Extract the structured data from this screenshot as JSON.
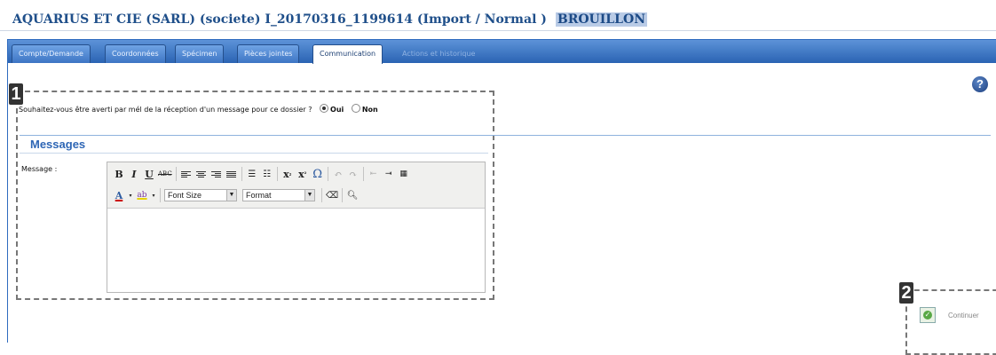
{
  "header": {
    "title": "AQUARIUS ET CIE (SARL) (societe)  I_20170316_1199614 (Import / Normal )",
    "status": "BROUILLON"
  },
  "tabs": [
    {
      "label": "Compte/Demande",
      "state": "normal"
    },
    {
      "label": "Coordonnées",
      "state": "normal"
    },
    {
      "label": "Spécimen",
      "state": "normal"
    },
    {
      "label": "Pièces jointes",
      "state": "normal"
    },
    {
      "label": "Communication",
      "state": "active"
    },
    {
      "label": "Actions et historique",
      "state": "disabled"
    }
  ],
  "help_icon": "question-mark-icon",
  "callouts": [
    "1",
    "2"
  ],
  "notification": {
    "question": "Souhaitez-vous être averti par mél de la réception d'un message pour ce dossier ?",
    "options": [
      {
        "label": "Oui",
        "selected": true
      },
      {
        "label": "Non",
        "selected": false
      }
    ]
  },
  "messages": {
    "section_title": "Messages",
    "message_label": "Message :",
    "editor": {
      "font_size_placeholder": "Font Size",
      "format_placeholder": "Format",
      "content": ""
    }
  },
  "continue": {
    "label": "Continuer",
    "icon": "check-circle-icon"
  },
  "colors": {
    "title": "#1f4f8a",
    "status_bg": "#b9cbe6",
    "tab_bar": "#2a63b3",
    "section": "#2e66b5"
  }
}
